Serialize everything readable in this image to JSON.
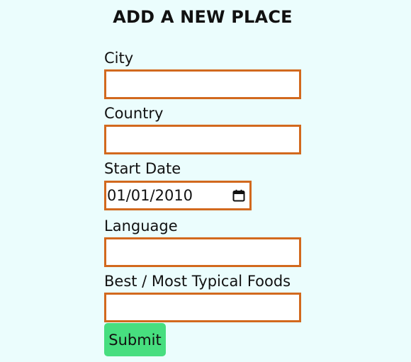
{
  "form": {
    "title": "ADD A NEW PLACE",
    "fields": {
      "city": {
        "label": "City",
        "value": ""
      },
      "country": {
        "label": "Country",
        "value": ""
      },
      "start_date": {
        "label": "Start Date",
        "value": "01/01/2010",
        "icon": "calendar-icon"
      },
      "language": {
        "label": "Language",
        "value": ""
      },
      "foods": {
        "label": "Best / Most Typical Foods",
        "value": ""
      }
    },
    "submit_label": "Submit"
  },
  "colors": {
    "background": "#ebfdfd",
    "field_border": "#d2691e",
    "submit_background": "#47de7f"
  }
}
